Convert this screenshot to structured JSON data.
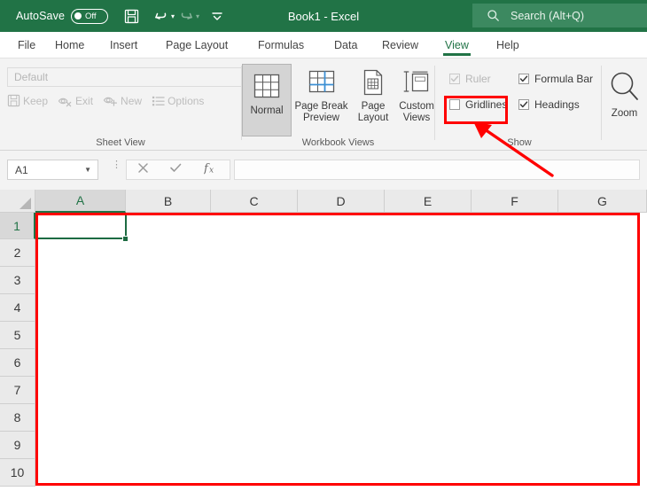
{
  "titlebar": {
    "autosave_label": "AutoSave",
    "autosave_state": "Off",
    "save_icon": "save-icon",
    "undo_icon": "undo-icon",
    "redo_icon": "redo-icon",
    "more_icon": "customize-quick-access-toolbar-icon",
    "document_title": "Book1 - Excel",
    "search_placeholder": "Search (Alt+Q)",
    "search_icon": "search-icon",
    "bg_color": "#217346",
    "search_bg_color": "#3c8960"
  },
  "tabs": [
    {
      "label": "File",
      "active": false
    },
    {
      "label": "Home",
      "active": false
    },
    {
      "label": "Insert",
      "active": false
    },
    {
      "label": "Page Layout",
      "active": false
    },
    {
      "label": "Formulas",
      "active": false
    },
    {
      "label": "Data",
      "active": false
    },
    {
      "label": "Review",
      "active": false
    },
    {
      "label": "View",
      "active": true
    },
    {
      "label": "Help",
      "active": false
    }
  ],
  "ribbon": {
    "active_tab_accent": "#217346",
    "sheet_view": {
      "group_label": "Sheet View",
      "combo_value": "Default",
      "combo_enabled": false,
      "buttons": [
        {
          "label": "Keep",
          "icon": "save-icon",
          "enabled": false
        },
        {
          "label": "Exit",
          "icon": "eye-exit-icon",
          "enabled": false
        },
        {
          "label": "New",
          "icon": "eye-new-icon",
          "enabled": false
        },
        {
          "label": "Options",
          "icon": "list-options-icon",
          "enabled": false
        }
      ]
    },
    "workbook_views": {
      "group_label": "Workbook Views",
      "buttons": [
        {
          "label": "Normal",
          "icon": "normal-view-icon",
          "selected": true
        },
        {
          "label": "Page Break\nPreview",
          "line1": "Page Break",
          "line2": "Preview",
          "icon": "page-break-preview-icon",
          "selected": false
        },
        {
          "label": "Page Layout",
          "line1": "Page",
          "line2": "Layout",
          "icon": "page-layout-icon",
          "selected": false
        },
        {
          "label": "Custom Views",
          "line1": "Custom",
          "line2": "Views",
          "icon": "custom-views-icon",
          "selected": false
        }
      ]
    },
    "show": {
      "group_label": "Show",
      "checkboxes": [
        {
          "label": "Ruler",
          "checked": true,
          "enabled": false,
          "highlighted": false
        },
        {
          "label": "Formula Bar",
          "checked": true,
          "enabled": true,
          "highlighted": false
        },
        {
          "label": "Gridlines",
          "checked": false,
          "enabled": true,
          "highlighted": true
        },
        {
          "label": "Headings",
          "checked": true,
          "enabled": true,
          "highlighted": false
        }
      ]
    },
    "zoom": {
      "label": "Zoom",
      "icon": "magnifier-icon"
    }
  },
  "formula_bar": {
    "name_box_value": "A1",
    "cancel_icon": "cancel-x-icon",
    "enter_icon": "enter-check-icon",
    "function_icon": "fx-insert-function-icon",
    "formula_value": ""
  },
  "grid": {
    "select_all_icon": "select-all-corner-icon",
    "columns": [
      "A",
      "B",
      "C",
      "D",
      "E",
      "F",
      "G"
    ],
    "active_column": "A",
    "rows": [
      "1",
      "2",
      "3",
      "4",
      "5",
      "6",
      "7",
      "8",
      "9",
      "10"
    ],
    "active_row": "1",
    "active_cell": "A1",
    "gridlines_visible": false,
    "selection_color": "#1d6b42"
  },
  "annotations": {
    "highlight_color": "#ff0000",
    "gridlines_highlight_target": "Gridlines",
    "grid_area_highlight_target": "worksheet-grid"
  }
}
